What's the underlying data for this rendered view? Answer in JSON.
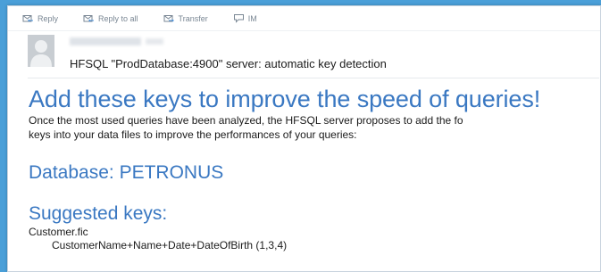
{
  "toolbar": {
    "reply_label": "Reply",
    "reply_all_label": "Reply to all",
    "forward_label": "Transfer",
    "im_label": "IM"
  },
  "message": {
    "subject": "HFSQL \"ProdDatabase:4900\" server: automatic key detection"
  },
  "content": {
    "headline": "Add these keys to improve the speed of queries!",
    "intro_line1": "Once the most used queries have been analyzed, the HFSQL server proposes to add the fo",
    "intro_line2": "keys into your data files to improve the performances of your queries:",
    "database_heading": "Database: PETRONUS",
    "suggested_heading": "Suggested keys:",
    "file_name": "Customer.fic",
    "key_line": "CustomerName+Name+Date+DateOfBirth (1,3,4)"
  },
  "colors": {
    "background": "#4a9fd8",
    "heading_blue": "#3a78c2",
    "toolbar_text": "#7a8794"
  }
}
